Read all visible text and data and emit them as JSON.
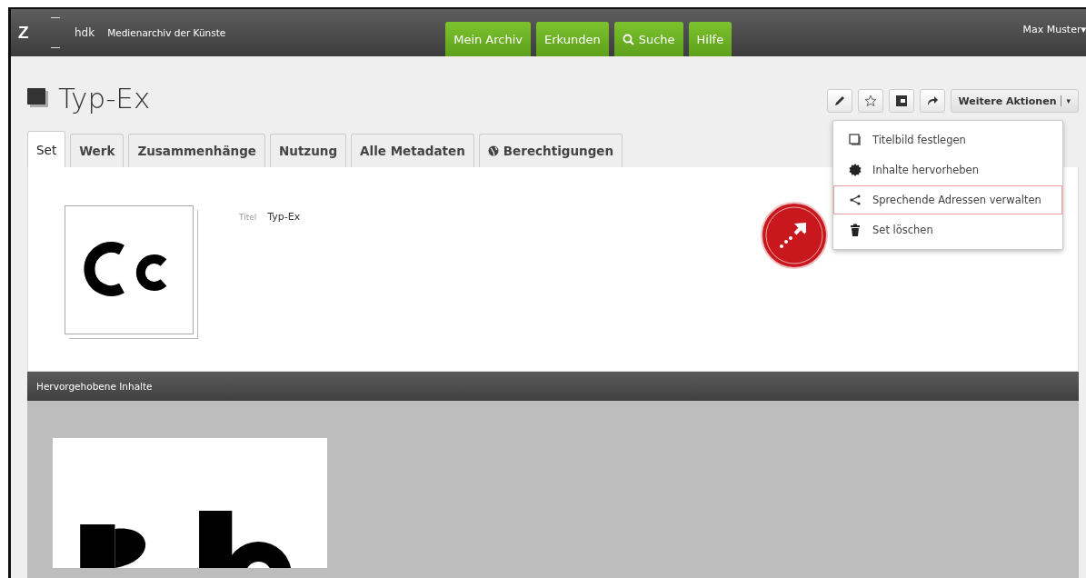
{
  "top_bar": {
    "logo": "Z",
    "org": "hdk",
    "app_name": "Medienarchiv der Künste",
    "nav": [
      {
        "label": "Mein Archiv",
        "kind": "plain"
      },
      {
        "label": "Erkunden",
        "kind": "plain"
      },
      {
        "label": "Suche",
        "kind": "search"
      },
      {
        "label": "Hilfe",
        "kind": "plain"
      }
    ],
    "user": "Max Muster",
    "user_caret": "▾"
  },
  "page": {
    "title": "Typ-Ex",
    "toolbar": {
      "buttons": [
        {
          "kind": "edit"
        },
        {
          "kind": "favorite"
        },
        {
          "kind": "cover"
        },
        {
          "kind": "share"
        }
      ],
      "more_label": "Weitere Aktionen",
      "more_caret": "▾",
      "expanded": true
    },
    "menu": [
      {
        "label": "Titelbild festlegen",
        "kind": "cover",
        "selected": false
      },
      {
        "label": "Inhalte hervorheben",
        "kind": "highlight",
        "selected": false
      },
      {
        "label": "Sprechende Adressen verwalten",
        "kind": "share",
        "selected": true
      },
      {
        "label": "Set löschen",
        "kind": "delete",
        "selected": false
      }
    ],
    "tabs": [
      {
        "label": "Set",
        "selected": true,
        "kind": "plain"
      },
      {
        "label": "Werk",
        "selected": false,
        "kind": "plain"
      },
      {
        "label": "Zusammenhänge",
        "selected": false,
        "kind": "plain"
      },
      {
        "label": "Nutzung",
        "selected": false,
        "kind": "plain"
      },
      {
        "label": "Alle Metadaten",
        "selected": false,
        "kind": "plain"
      },
      {
        "label": "Berechtigungen",
        "selected": false,
        "kind": "globe"
      }
    ],
    "metadata": [
      {
        "key": "Titel",
        "value": "Typ-Ex"
      }
    ],
    "highlighted": {
      "heading": "Hervorgehobene Inhalte"
    }
  }
}
